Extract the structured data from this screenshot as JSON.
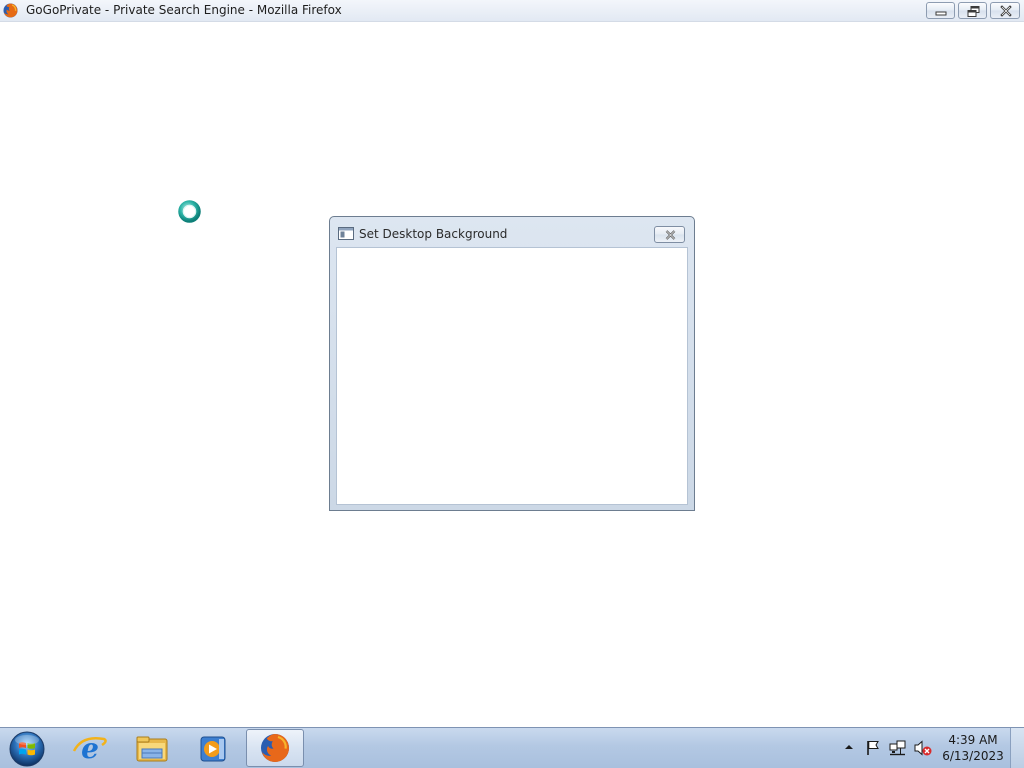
{
  "browser": {
    "window_title": "GoGoPrivate - Private Search Engine - Mozilla Firefox",
    "icon": "firefox-icon",
    "controls": {
      "minimize": "minimize-icon",
      "maximize": "restore-icon",
      "close": "close-icon"
    }
  },
  "page": {
    "loading_indicator": "spinner-icon"
  },
  "dialog": {
    "title": "Set Desktop Background",
    "icon": "window-icon",
    "close": "close-icon"
  },
  "taskbar": {
    "start": "windows-start-icon",
    "pinned": [
      {
        "name": "Internet Explorer",
        "icon": "internet-explorer-icon"
      },
      {
        "name": "Windows Explorer",
        "icon": "folder-icon"
      },
      {
        "name": "Windows Media Player",
        "icon": "media-player-icon"
      },
      {
        "name": "Mozilla Firefox",
        "icon": "firefox-icon",
        "active": true
      }
    ],
    "tray": {
      "icons": [
        "show-hidden-icons-arrow",
        "action-center-flag-icon",
        "network-icon",
        "volume-muted-icon"
      ],
      "time": "4:39 AM",
      "date": "6/13/2023"
    }
  },
  "colors": {
    "taskbar": "#b3c8e3",
    "titlebar": "#e2e9f3",
    "dialog_frame": "#ccd8e6",
    "spinner": "#2bb3a6"
  }
}
